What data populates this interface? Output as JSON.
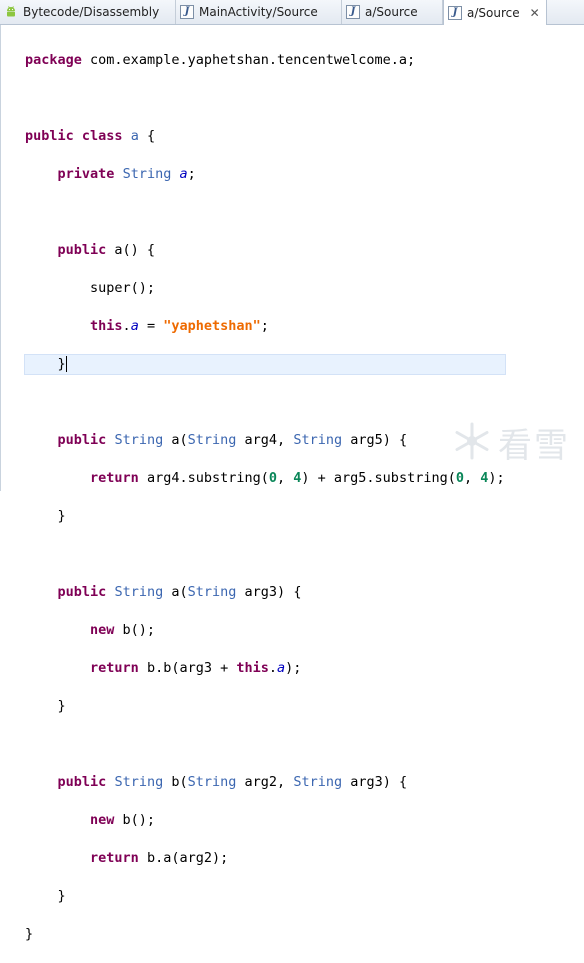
{
  "tabs": [
    {
      "label": "Bytecode/Disassembly",
      "icon": "android-icon"
    },
    {
      "label": "MainActivity/Source",
      "icon": "java-file-icon"
    },
    {
      "label": "a/Source",
      "icon": "java-file-icon"
    },
    {
      "label": "a/Source",
      "icon": "java-file-icon",
      "active": true,
      "close": "✕"
    }
  ],
  "code": {
    "pkg_keyword": "package",
    "pkg_name": "com.example.yaphetshan.tencentwelcome.a;",
    "public": "public",
    "class": "class",
    "private": "private",
    "this": "this",
    "return": "return",
    "new": "new",
    "String": "String",
    "class_name": "a",
    "field": "a",
    "string_literal": "\"yaphetshan\"",
    "num_0": "0",
    "num_4": "4",
    "m1_name": "a",
    "m2_name": "a",
    "m3_name": "b",
    "l_class_open": " {",
    "l_field_end": ";",
    "l_ctor_sig": " a() {",
    "l_super": "super();",
    "l_assign_mid": " = ",
    "l_assign_end": ";",
    "l_sig1_a": "(",
    "l_sig1_b": " arg4, ",
    "l_sig1_c": " arg5) {",
    "l_ret1_a": " arg4.substring(",
    "l_ret1_b": ", ",
    "l_ret1_c": ") + arg5.substring(",
    "l_ret1_d": ", ",
    "l_ret1_e": ");",
    "l_sig2_a": "(",
    "l_sig2_b": " arg3) {",
    "l_new_b": " b();",
    "l_ret2": " b.b(arg3 + ",
    "l_ret2_end": ");",
    "l_sig3_a": "(",
    "l_sig3_b": " arg2, ",
    "l_sig3_c": " arg3) {",
    "l_ret3": " b.a(arg2);",
    "brace_close": "}"
  },
  "watermark": {
    "text": "看雪",
    "icon": "snowflake-icon"
  }
}
